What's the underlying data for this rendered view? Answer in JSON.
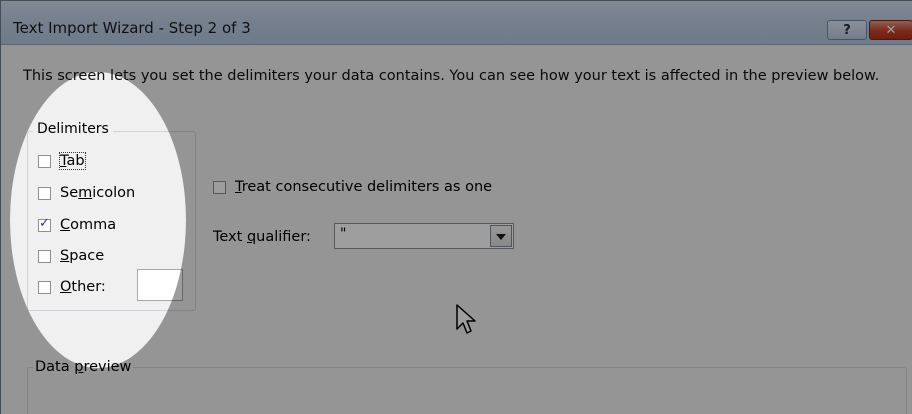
{
  "window": {
    "title": "Text Import Wizard - Step 2 of 3",
    "help_label": "?",
    "close_label": "✕"
  },
  "intro_text": "This screen lets you set the delimiters your data contains.  You can see how your text is affected in the preview below.",
  "delimiters": {
    "group_label": "Delimiters",
    "items": [
      {
        "prefix": "",
        "mnemonic": "T",
        "suffix": "ab",
        "checked": false
      },
      {
        "prefix": "Se",
        "mnemonic": "m",
        "suffix": "icolon",
        "checked": false
      },
      {
        "prefix": "",
        "mnemonic": "C",
        "suffix": "omma",
        "checked": true
      },
      {
        "prefix": "",
        "mnemonic": "S",
        "suffix": "pace",
        "checked": false
      },
      {
        "prefix": "",
        "mnemonic": "O",
        "suffix": "ther:",
        "checked": false
      }
    ],
    "other_value": ""
  },
  "consecutive": {
    "prefix": "",
    "mnemonic": "T",
    "suffix": "reat consecutive delimiters as one",
    "checked": false
  },
  "text_qualifier": {
    "label_prefix": "Text ",
    "label_mnemonic": "q",
    "label_suffix": "ualifier:",
    "value": "\""
  },
  "data_preview": {
    "label_prefix": "Data ",
    "label_mnemonic": "p",
    "label_suffix": "review"
  },
  "icons": {
    "cursor": "mouse-pointer-icon",
    "dropdown": "chevron-down-icon"
  },
  "colors": {
    "title_gradient_top": "#cfdcec",
    "close_button": "#c8452a",
    "dialog_bg": "#f0f0f0",
    "spotlight_dim": "rgba(0,0,0,0.38)"
  }
}
